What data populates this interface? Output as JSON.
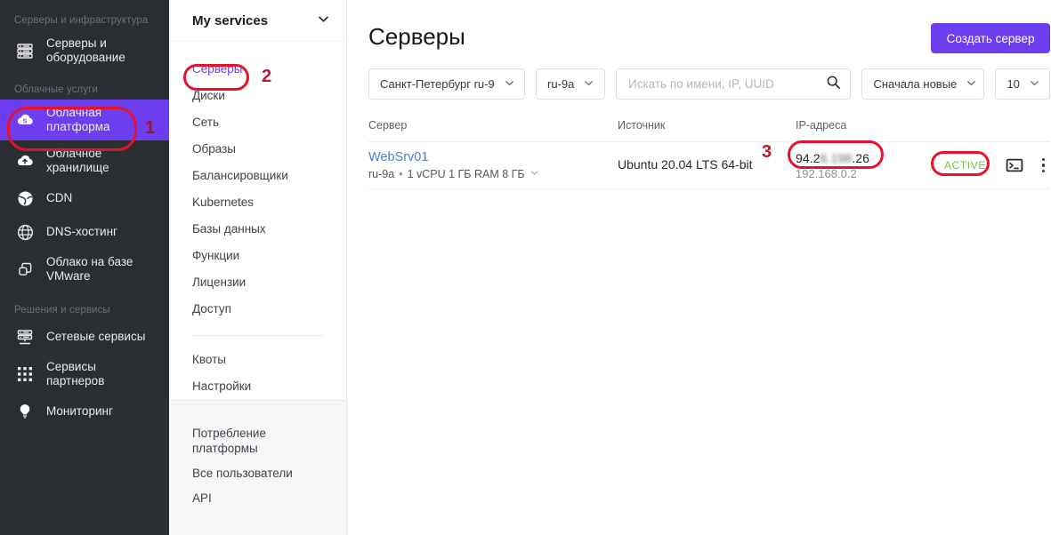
{
  "sidebar": {
    "groups": [
      {
        "title": "Серверы и инфраструктура",
        "items": [
          {
            "label": "Серверы и оборудование",
            "icon": "server-rack-icon",
            "active": false
          }
        ]
      },
      {
        "title": "Облачные услуги",
        "items": [
          {
            "label": "Облачная платформа",
            "icon": "cloud-platform-icon",
            "active": true
          },
          {
            "label": "Облачное хранилище",
            "icon": "cloud-upload-icon",
            "active": false
          },
          {
            "label": "CDN",
            "icon": "globe-cdn-icon",
            "active": false
          },
          {
            "label": "DNS-хостинг",
            "icon": "globe-grid-icon",
            "active": false
          },
          {
            "label": "Облако на базе VMware",
            "icon": "stacked-squares-icon",
            "active": false
          }
        ]
      },
      {
        "title": "Решения и сервисы",
        "items": [
          {
            "label": "Сетевые сервисы",
            "icon": "network-server-icon",
            "active": false
          },
          {
            "label": "Сервисы партнеров",
            "icon": "grid-dots-icon",
            "active": false
          },
          {
            "label": "Мониторинг",
            "icon": "lightbulb-icon",
            "active": false
          }
        ]
      }
    ]
  },
  "subnav": {
    "header": {
      "title": "My services",
      "chevron": "chevron-down-icon"
    },
    "items": [
      {
        "label": "Серверы",
        "current": true
      },
      {
        "label": "Диски",
        "current": false
      },
      {
        "label": "Сеть",
        "current": false
      },
      {
        "label": "Образы",
        "current": false
      },
      {
        "label": "Балансировщики",
        "current": false
      },
      {
        "label": "Kubernetes",
        "current": false
      },
      {
        "label": "Базы данных",
        "current": false
      },
      {
        "label": "Функции",
        "current": false
      },
      {
        "label": "Лицензии",
        "current": false
      },
      {
        "label": "Доступ",
        "current": false
      }
    ],
    "items_after_sep": [
      {
        "label": "Квоты",
        "current": false
      },
      {
        "label": "Настройки",
        "current": false
      }
    ],
    "footer_items": [
      {
        "label": "Потребление платформы"
      },
      {
        "label": "Все пользователи"
      },
      {
        "label": "API"
      }
    ]
  },
  "main": {
    "title": "Серверы",
    "create_button": "Создать сервер",
    "toolbar": {
      "region": "Санкт-Петербург ru-9",
      "zone": "ru-9a",
      "search_placeholder": "Искать по имени, IP, UUID",
      "search_value": "",
      "search_icon": "search-icon",
      "sort": "Сначала новые",
      "page_size": "10"
    },
    "table": {
      "columns": [
        "Сервер",
        "Источник",
        "IP-адреса",
        ""
      ],
      "rows": [
        {
          "name": "WebSrv01",
          "zone": "ru-9a",
          "specs": "1 vCPU  1 ГБ RAM  8 ГБ",
          "source": "Ubuntu 20.04 LTS 64-bit",
          "ip_public_prefix": "94.2",
          "ip_public_blurred": "6.198",
          "ip_public_suffix": ".26",
          "ip_private": "192.168.0.2",
          "status": "ACTIVE",
          "console_icon": "terminal-icon",
          "menu_icon": "kebab-menu-icon"
        }
      ]
    }
  },
  "annotations": {
    "markers": [
      {
        "number": "1",
        "target": "cloud-platform-sidebar-item"
      },
      {
        "number": "2",
        "target": "subnav-item-servers"
      },
      {
        "number": "3",
        "target": "public-ip-address"
      }
    ],
    "ring_color": "#e8112d",
    "number_color": "#c2132b"
  }
}
